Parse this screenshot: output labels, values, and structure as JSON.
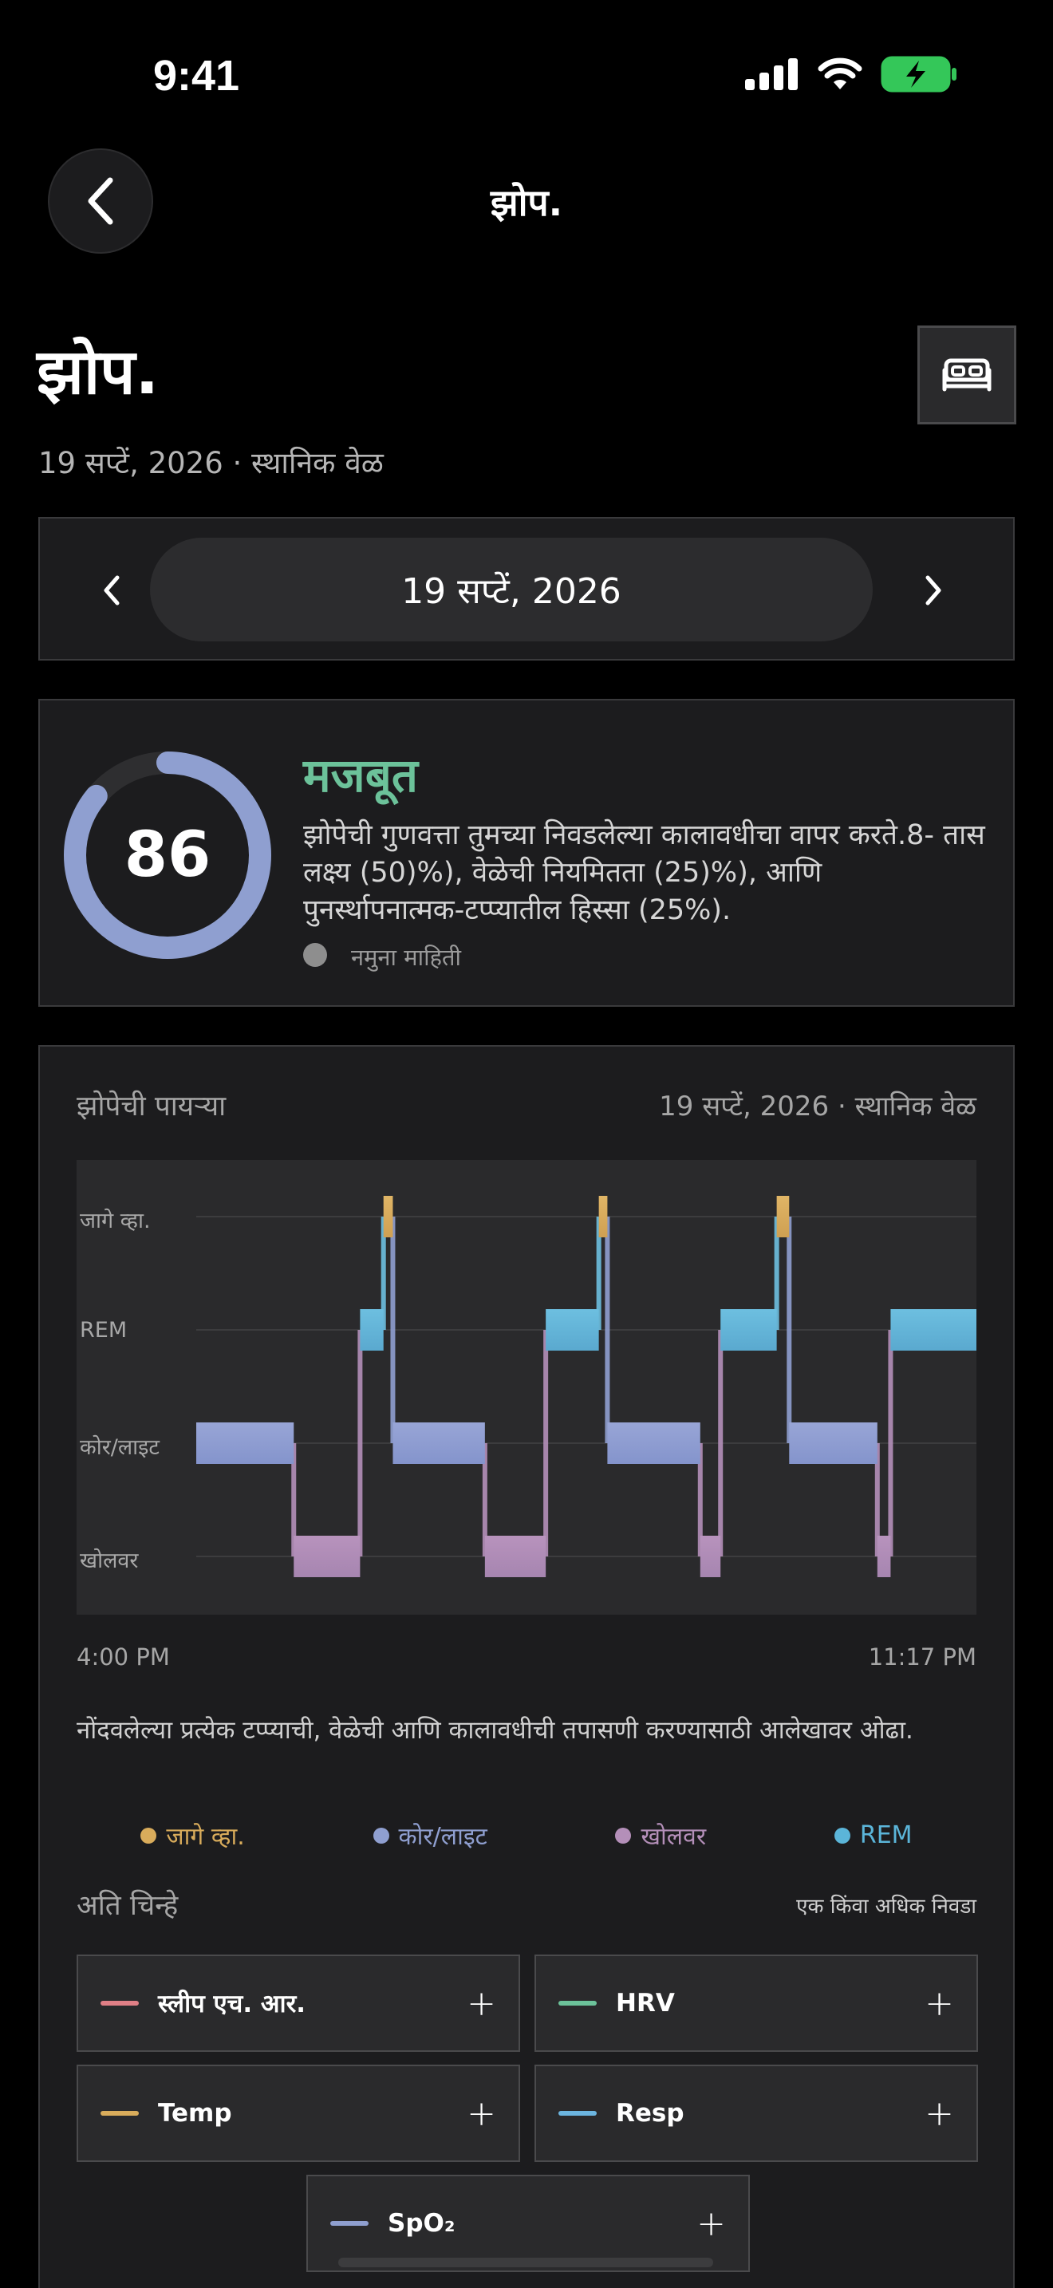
{
  "status": {
    "time": "9:41"
  },
  "nav": {
    "title": "झोप."
  },
  "header": {
    "title": "झोप.",
    "subtitle": "19 सप्टें, 2026 · स्थानिक वेळ"
  },
  "date_picker": {
    "value": "19 सप्टें, 2026"
  },
  "score": {
    "value": "86",
    "fraction": 0.86,
    "label": "मजबूत",
    "description": "झोपेची गुणवत्ता तुमच्या निवडलेल्या कालावधीचा वापर करते.8- तास लक्ष्य (50)%), वेळेची नियमितता (25)%), आणि पुनर्स्थापनात्मक-टप्प्यातील हिस्सा (25%).",
    "sample": "नमुना माहिती"
  },
  "stages": {
    "title": "झोपेची पायऱ्या",
    "date": "19 सप्टें, 2026 · स्थानिक वेळ",
    "levels": [
      "जागे व्हा.",
      "REM",
      "कोर/लाइट",
      "खोलवर"
    ],
    "time_start": "4:00 PM",
    "time_end": "11:17 PM",
    "hint": "नोंदवलेल्या प्रत्येक टप्प्याची, वेळेची आणि कालावधीची तपासणी करण्यासाठी आलेखावर ओढा.",
    "legend": [
      {
        "label": "जागे व्हा.",
        "color": "#d9ac5b"
      },
      {
        "label": "कोर/लाइट",
        "color": "#8f9fd0"
      },
      {
        "label": "खोलवर",
        "color": "#b48fb9"
      },
      {
        "label": "REM",
        "color": "#5bb5d9"
      }
    ]
  },
  "chart_data": {
    "type": "step",
    "x_start": "4:00 PM",
    "x_end": "11:17 PM",
    "levels": [
      "खोलवर",
      "कोर/लाइट",
      "REM",
      "जागे व्हा."
    ],
    "segments": [
      {
        "stage": "कोर/लाइट",
        "start": 0.0,
        "end": 0.125
      },
      {
        "stage": "खोलवर",
        "start": 0.125,
        "end": 0.21
      },
      {
        "stage": "REM",
        "start": 0.21,
        "end": 0.24
      },
      {
        "stage": "जागे व्हा.",
        "start": 0.24,
        "end": 0.252
      },
      {
        "stage": "कोर/लाइट",
        "start": 0.252,
        "end": 0.37
      },
      {
        "stage": "खोलवर",
        "start": 0.37,
        "end": 0.448
      },
      {
        "stage": "REM",
        "start": 0.448,
        "end": 0.516
      },
      {
        "stage": "जागे व्हा.",
        "start": 0.516,
        "end": 0.527
      },
      {
        "stage": "कोर/लाइट",
        "start": 0.527,
        "end": 0.646
      },
      {
        "stage": "खोलवर",
        "start": 0.646,
        "end": 0.672
      },
      {
        "stage": "REM",
        "start": 0.672,
        "end": 0.744
      },
      {
        "stage": "जागे व्हा.",
        "start": 0.744,
        "end": 0.76
      },
      {
        "stage": "कोर/लाइट",
        "start": 0.76,
        "end": 0.873
      },
      {
        "stage": "खोलवर",
        "start": 0.873,
        "end": 0.89
      },
      {
        "stage": "REM",
        "start": 0.89,
        "end": 1.0
      }
    ]
  },
  "overlays": {
    "title": "अति चिन्हे",
    "hint": "एक किंवा अधिक निवडा",
    "items": [
      {
        "label": "स्लीप एच. आर.",
        "color": "#e07f86",
        "plus": "+"
      },
      {
        "label": "HRV",
        "color": "#6cc29a",
        "plus": "+"
      },
      {
        "label": "Temp",
        "color": "#d9ac5b",
        "plus": "+"
      },
      {
        "label": "Resp",
        "color": "#6cb5e0",
        "plus": "+"
      },
      {
        "label": "SpO₂",
        "color": "#8f9fd0",
        "plus": "+"
      }
    ]
  }
}
